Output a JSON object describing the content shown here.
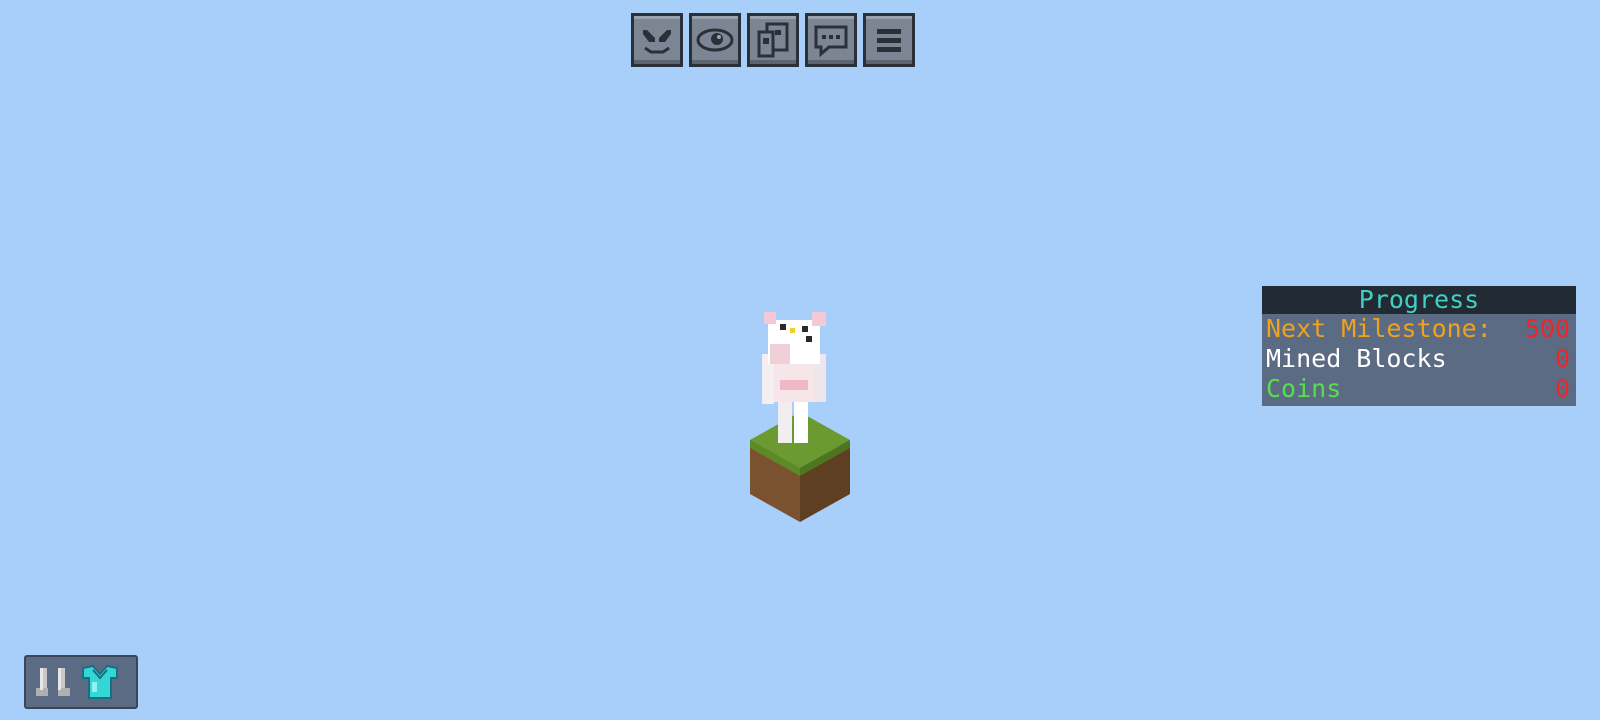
{
  "toolbar": {
    "buttons": [
      {
        "icon": "emote-face-icon"
      },
      {
        "icon": "eye-icon"
      },
      {
        "icon": "profile-card-icon"
      },
      {
        "icon": "chat-bubble-icon"
      },
      {
        "icon": "hamburger-menu-icon"
      }
    ]
  },
  "scoreboard": {
    "title": "Progress",
    "rows": [
      {
        "label": "Next Milestone:",
        "value": "500",
        "label_color": "#f0a21c"
      },
      {
        "label": "Mined Blocks",
        "value": "0",
        "label_color": "#ffffff"
      },
      {
        "label": "Coins",
        "value": "0",
        "label_color": "#55e04a"
      }
    ],
    "colors": {
      "title": "#3ed1c4",
      "value": "#e8282c"
    }
  },
  "equipment": {
    "items": [
      {
        "icon": "iron-boots-icon"
      },
      {
        "icon": "diamond-chestplate-icon"
      }
    ]
  },
  "colors": {
    "sky": "#a8cefa",
    "grass": "#6b9a30",
    "dirt": "#7a5230"
  }
}
